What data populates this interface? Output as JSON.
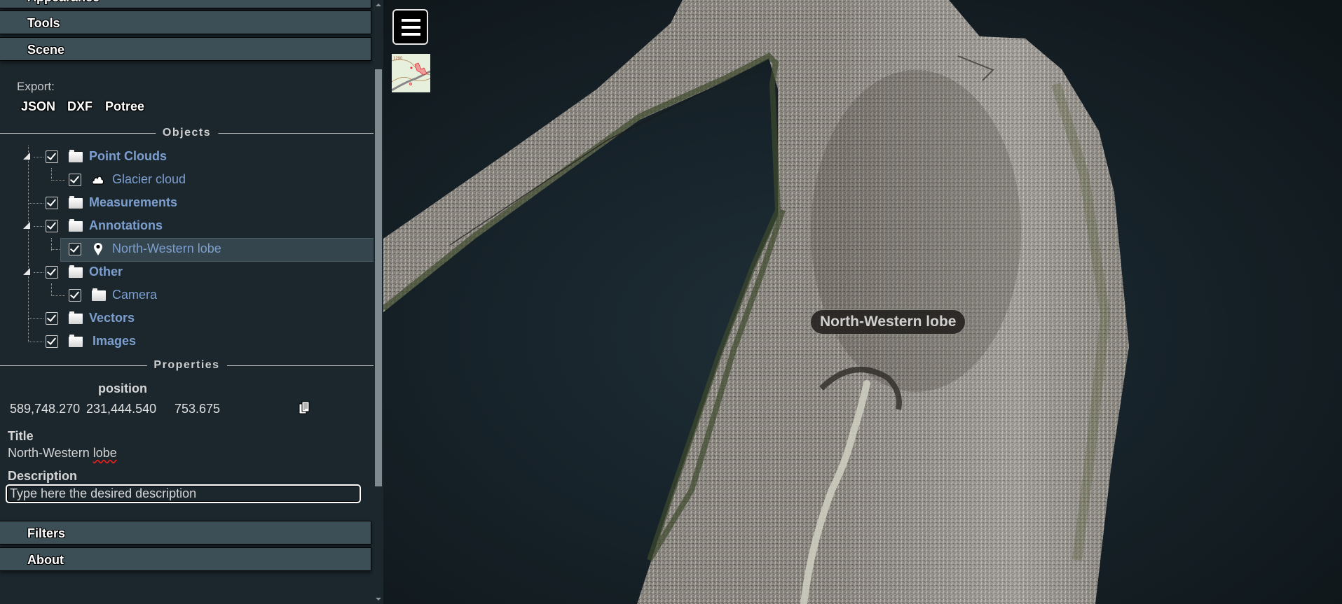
{
  "sidebar": {
    "accordion": {
      "appearance": "Appearance",
      "tools": "Tools",
      "scene": "Scene",
      "filters": "Filters",
      "about": "About"
    },
    "export": {
      "label": "Export:",
      "formats": [
        "JSON",
        "DXF",
        "Potree"
      ]
    },
    "objects": {
      "heading": "Objects",
      "tree": [
        {
          "label": "Point Clouds",
          "checked": true,
          "icon": "folder-icon",
          "expanded": true
        },
        {
          "label": "Glacier cloud",
          "checked": true,
          "icon": "cloud-icon"
        },
        {
          "label": "Measurements",
          "checked": true,
          "icon": "folder-icon"
        },
        {
          "label": "Annotations",
          "checked": true,
          "icon": "folder-icon",
          "expanded": true
        },
        {
          "label": "North-Western lobe",
          "checked": true,
          "icon": "map-pin-icon",
          "selected": true
        },
        {
          "label": "Other",
          "checked": true,
          "icon": "folder-icon",
          "expanded": true
        },
        {
          "label": "Camera",
          "checked": true,
          "icon": "folder-icon"
        },
        {
          "label": "Vectors",
          "checked": true,
          "icon": "folder-icon"
        },
        {
          "label": "Images",
          "checked": true,
          "icon": "folder-icon"
        }
      ]
    },
    "properties": {
      "heading": "Properties",
      "position_label": "position",
      "position": {
        "x": "589,748.270",
        "y": "231,444.540",
        "z": "753.675"
      },
      "copy_icon": "copy-icon",
      "title_label": "Title",
      "title_value": "North-Western lobe",
      "description_label": "Description",
      "description_placeholder": "Type here the desired description"
    }
  },
  "viewer": {
    "menu_icon": "hamburger-menu-icon",
    "minimap_label": "1290",
    "annotation": "North-Western lobe",
    "colors": {
      "background_edge": "#0e1518",
      "background_center": "#1f2e37",
      "annotation_text": "#cfcfcf",
      "link_blue": "#7d9fcf"
    }
  }
}
